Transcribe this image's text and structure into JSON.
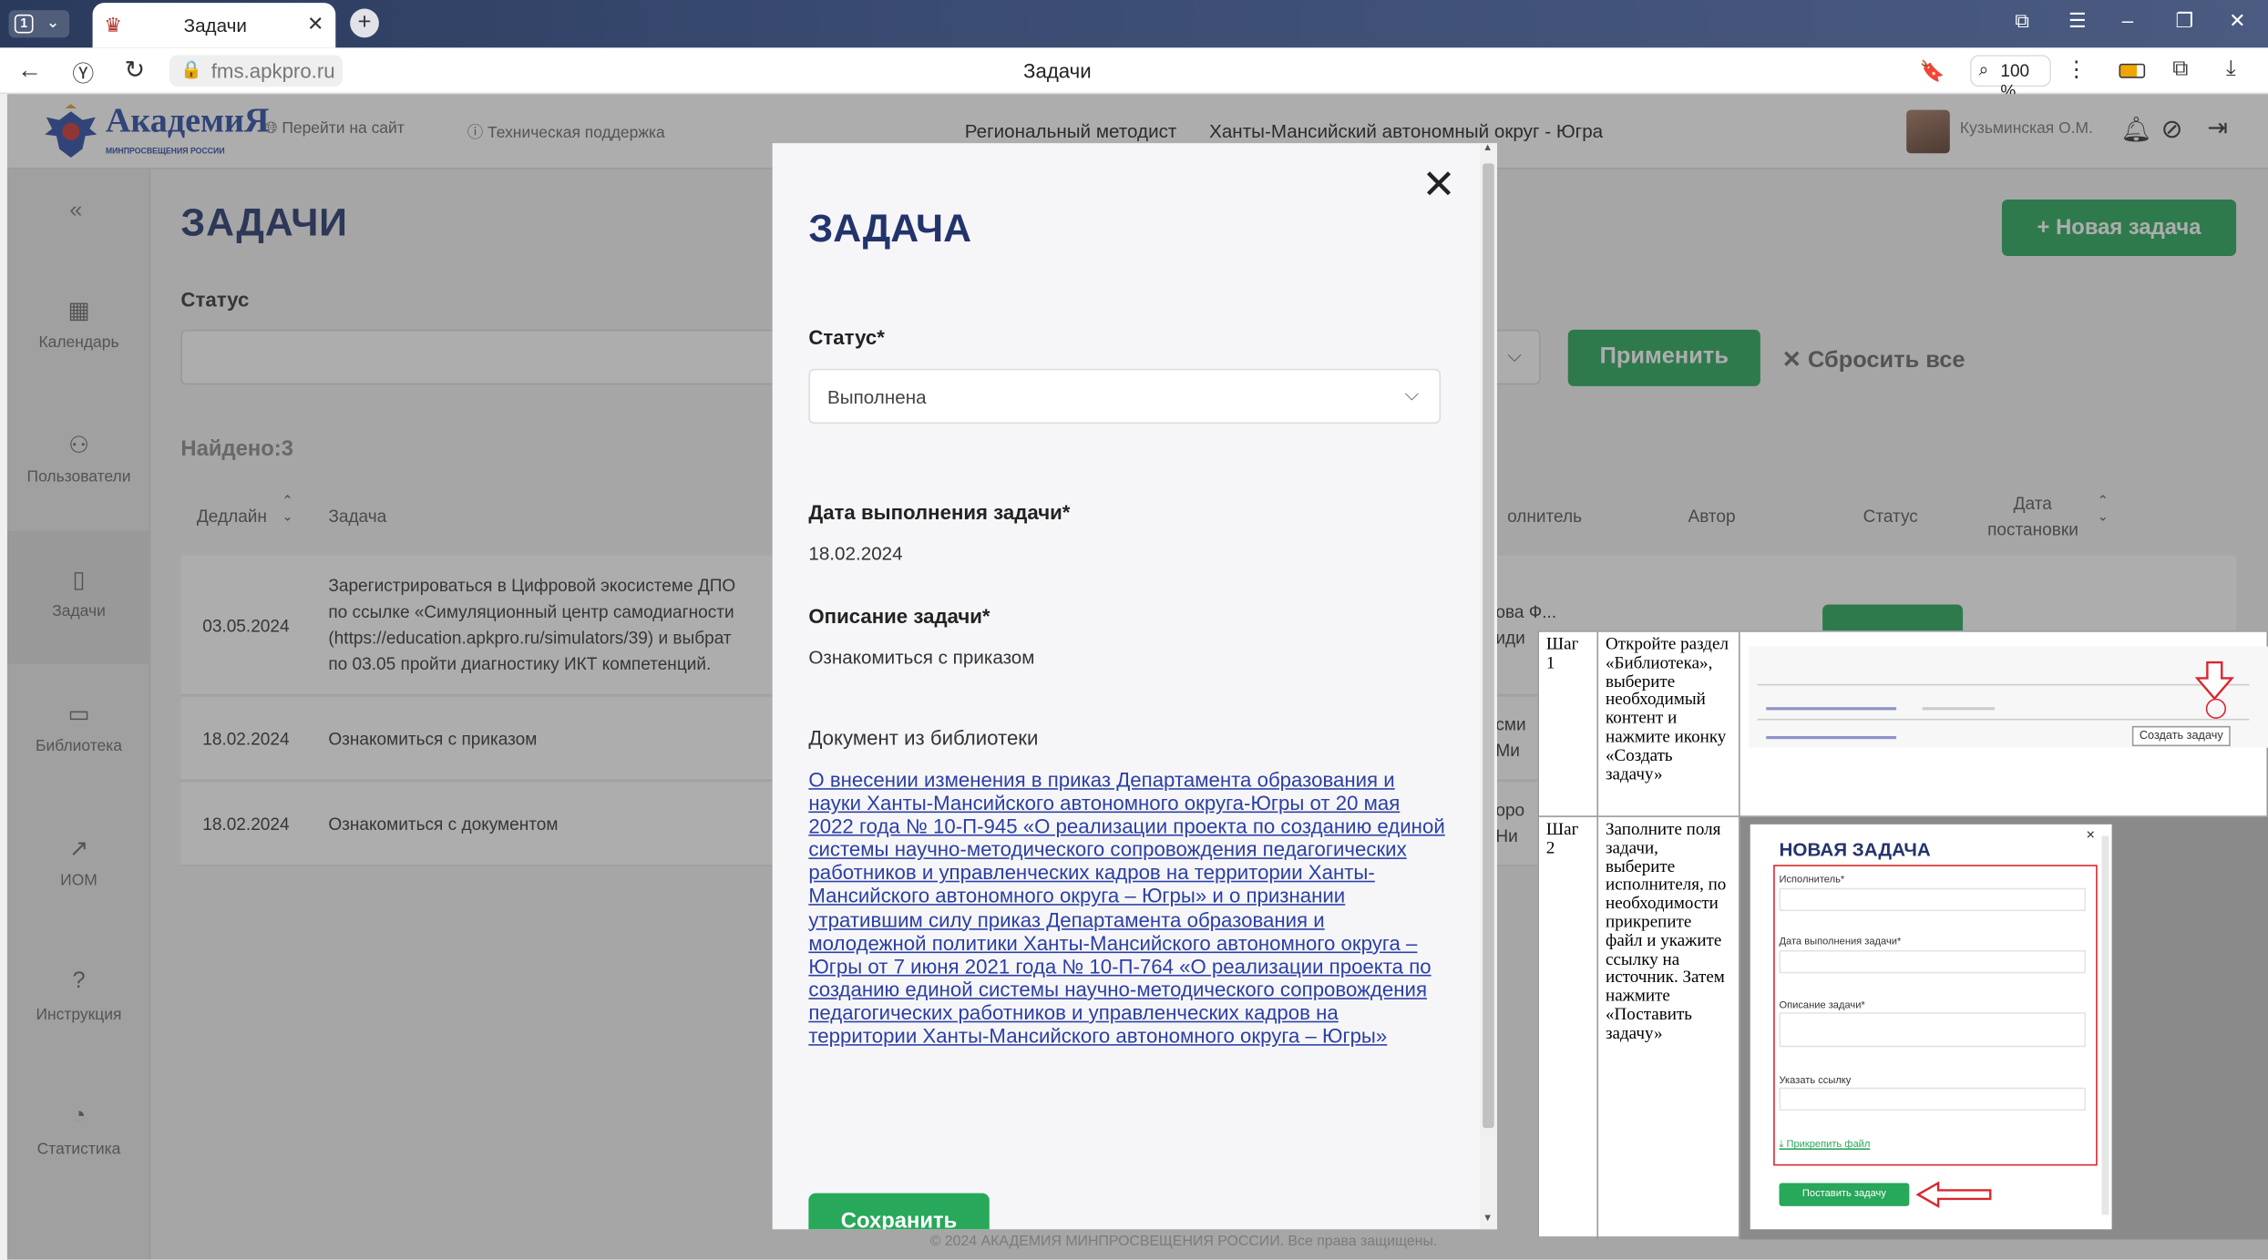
{
  "browser": {
    "tab_count": "1",
    "tab_title": "Задачи",
    "url": "fms.apkpro.ru",
    "page_title": "Задачи",
    "zoom": "100 %"
  },
  "header": {
    "logo_text": "АкадемиЯ",
    "logo_sub": "МИНПРОСВЕЩЕНИЯ РОССИИ",
    "goto_site": "Перейти на сайт",
    "support": "Техническая поддержка",
    "role": "Региональный методист",
    "region": "Ханты-Мансийский автономный округ - Югра",
    "user": "Кузьминская О.М."
  },
  "sidebar": {
    "collapse": "«",
    "items": [
      {
        "label": "Календарь",
        "icon": "calendar-icon"
      },
      {
        "label": "Пользователи",
        "icon": "users-icon"
      },
      {
        "label": "Задачи",
        "icon": "clipboard-icon"
      },
      {
        "label": "Библиотека",
        "icon": "book-icon"
      },
      {
        "label": "ИОМ",
        "icon": "trend-icon"
      },
      {
        "label": "Инструкция",
        "icon": "help-icon"
      },
      {
        "label": "Статистика",
        "icon": "pie-icon"
      }
    ]
  },
  "main": {
    "title": "ЗАДАЧИ",
    "new_task": "+ Новая задача",
    "status_label": "Статус",
    "apply": "Применить",
    "reset": "✕ Сбросить все",
    "found": "Найдено:3",
    "columns": {
      "deadline": "Дедлайн",
      "task": "Задача",
      "executor": "олнитель",
      "author": "Автор",
      "status": "Статус",
      "date1": "Дата",
      "date2": "постановки"
    },
    "rows": [
      {
        "deadline": "03.05.2024",
        "task1": "Зарегистрироваться в Цифровой экосистеме ДПО",
        "task2": "по ссылке «Симуляционный центр самодиагности",
        "task3": "(https://education.apkpro.ru/simulators/39) и выбрат",
        "task4": "по 03.05 пройти диагностику ИКТ компетенций.",
        "exec1": "ова Ф...",
        "exec2": "иди"
      },
      {
        "deadline": "18.02.2024",
        "task1": "Ознакомиться с приказом",
        "exec1": "сми",
        "exec2": "Ми"
      },
      {
        "deadline": "18.02.2024",
        "task1": "Ознакомиться с документом",
        "exec1": "оро",
        "exec2": "Ни"
      }
    ],
    "footer": "© 2024 АКАДЕМИЯ МИНПРОСВЕЩЕНИЯ РОССИИ. Все права защищены."
  },
  "modal": {
    "title": "ЗАДАЧА",
    "status_label": "Статус*",
    "status_value": "Выполнена",
    "date_label": "Дата выполнения задачи*",
    "date_value": "18.02.2024",
    "desc_label": "Описание задачи*",
    "desc_value": "Ознакомиться с приказом",
    "doc_label": "Документ из библиотеки",
    "doc_link": "О внесении изменения в приказ Департамента образования и науки Ханты-Мансийского автономного округа-Югры от 20 мая 2022 года № 10-П-945 «О реализации проекта по созданию единой системы научно-методического сопровождения педагогических работников и управленческих кадров на территории Ханты-Мансийского автономного округа – Югры» и о признании утратившим силу приказ Департамента образования и молодежной политики Ханты-Мансийского автономного округа – Югры от 7 июня 2021 года № 10-П-764 «О реализации проекта по созданию единой системы научно-методического сопровождения педагогических работников и управленческих кадров на территории Ханты-Мансийского автономного округа – Югры»",
    "save": "Сохранить"
  },
  "instruction": {
    "step1_label": "Шаг 1",
    "step1_text": "Откройте раздел «Библиотека», выберите необходимый контент и нажмите иконку «Создать задачу»",
    "step1_button": "Создать задачу",
    "step2_label": "Шаг 2",
    "step2_text": "Заполните поля задачи, выберите исполнителя, по необходимости прикрепите файл и укажите ссылку на источник. Затем нажмите «Поставить задачу»",
    "new_task_title": "НОВАЯ ЗАДАЧА",
    "f_executor": "Исполнитель*",
    "f_date": "Дата выполнения задачи*",
    "f_desc": "Описание задачи*",
    "f_link": "Указать ссылку",
    "attach": "Прикрепить файл",
    "submit": "Поставить задачу"
  },
  "colors": {
    "brand": "#23346c",
    "accent": "#27a85a",
    "link": "#2b3fa6",
    "highlight": "#d9262e"
  }
}
